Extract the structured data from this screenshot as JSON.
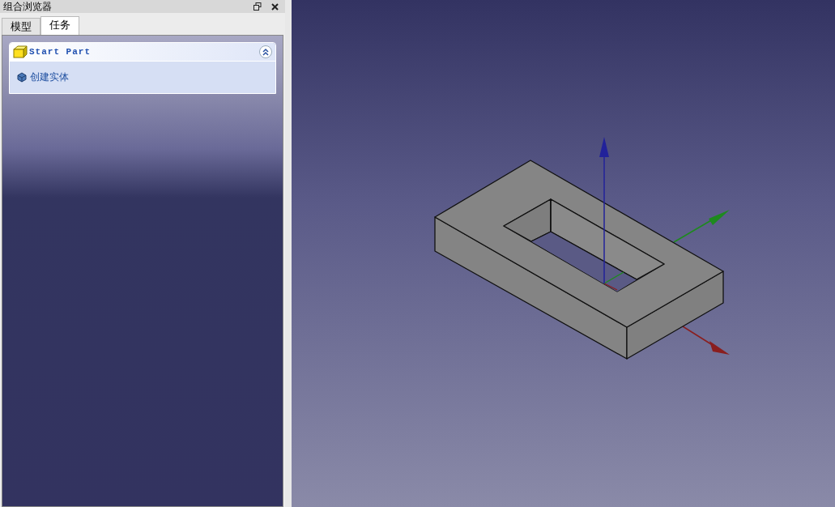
{
  "panel": {
    "title": "组合浏览器"
  },
  "tabs": [
    {
      "label": "模型",
      "selected": false
    },
    {
      "label": "任务",
      "selected": true
    }
  ],
  "task_box": {
    "title": "Start Part",
    "expanded": true,
    "actions": [
      "创建实体"
    ]
  }
}
